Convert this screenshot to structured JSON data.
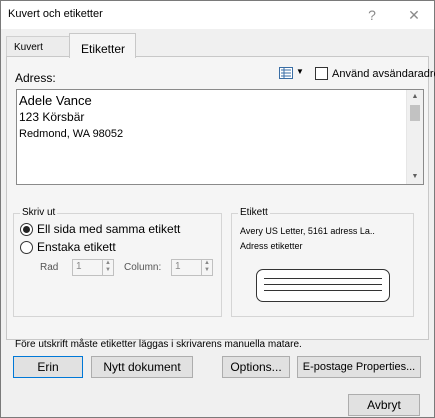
{
  "window": {
    "title": "Kuvert och etiketter",
    "help_glyph": "?",
    "close_glyph": "✕"
  },
  "tabs": [
    {
      "label": "Kuvert"
    },
    {
      "label": "Etiketter"
    }
  ],
  "address": {
    "label": "Adress:",
    "use_return_label": "Använd avsändaradress",
    "lines": [
      "Adele Vance",
      "123 Körsbär",
      "Redmond, WA 98052"
    ]
  },
  "print": {
    "group_label": "Skriv ut",
    "full_page_label": "Ell sida med samma etikett",
    "single_label": "Enstaka etikett",
    "row_label": "Rad",
    "row_value": "1",
    "column_label": "Column:",
    "column_value": "1",
    "selected": "full_page"
  },
  "label": {
    "group_label": "Etikett",
    "name": "Avery US Letter, 5161 adress La..",
    "description": "Adress etiketter"
  },
  "note": "Före utskrift måste etiketter läggas i skrivarens manuella matare.",
  "buttons": {
    "print": "Erin",
    "new_document": "Nytt dokument",
    "options": "Options...",
    "epostage": "E-postage Properties...",
    "cancel": "Avbryt"
  },
  "icons": {
    "address_book": "address-book-icon",
    "dropdown": "chevron-down-icon"
  }
}
